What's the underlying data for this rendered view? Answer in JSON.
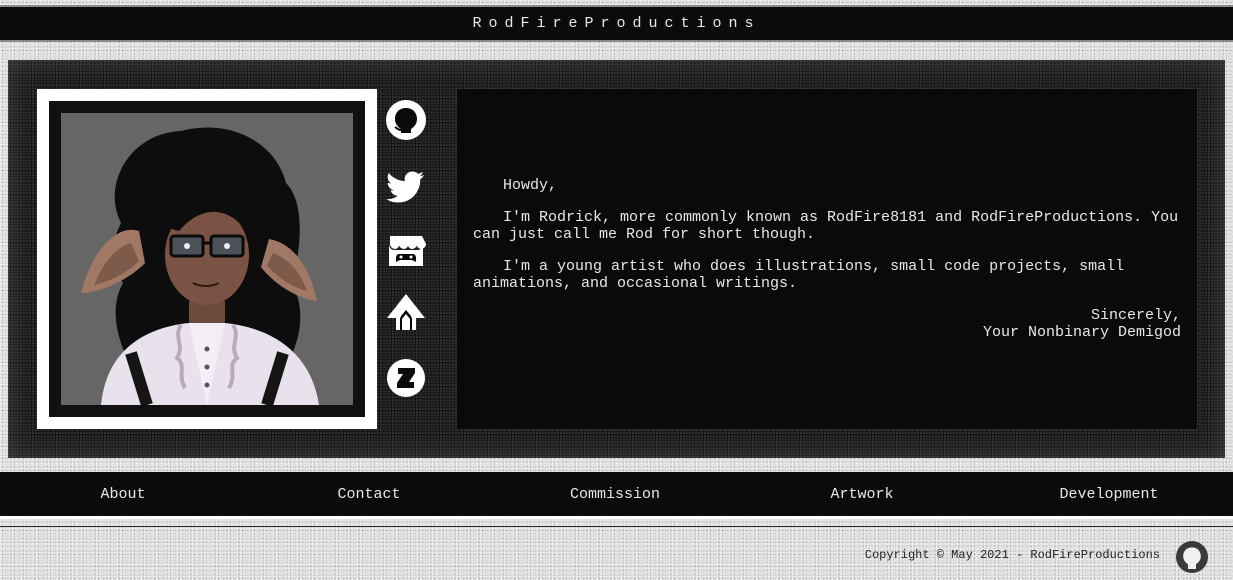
{
  "header": {
    "title": "RodFireProductions"
  },
  "portrait": {
    "alt": "Drawn portrait of Rod with curly black hair, glasses, floppy ears and a frilly white shirt"
  },
  "social": [
    {
      "name": "github-icon"
    },
    {
      "name": "twitter-icon"
    },
    {
      "name": "itchio-icon"
    },
    {
      "name": "artstation-style-icon"
    },
    {
      "name": "deviantart-icon"
    }
  ],
  "bio": {
    "greeting": "Howdy,",
    "paragraph1": "I'm Rodrick, more commonly known as RodFire8181 and RodFireProductions. You can just call me Rod for short though.",
    "paragraph2": "I'm a young artist who does illustrations, small code projects, small animations, and occasional writings.",
    "signoff": "Sincerely,",
    "signature": "Your Nonbinary Demigod"
  },
  "nav": {
    "items": [
      {
        "label": "About"
      },
      {
        "label": "Contact"
      },
      {
        "label": "Commission"
      },
      {
        "label": "Artwork"
      },
      {
        "label": "Development"
      }
    ]
  },
  "footer": {
    "copyright": "Copyright © May 2021 - RodFireProductions",
    "icon": "github-icon"
  },
  "colors": {
    "panel": "#0a0a0a",
    "text": "#e8e8e8",
    "page": "#dcdcdc"
  }
}
